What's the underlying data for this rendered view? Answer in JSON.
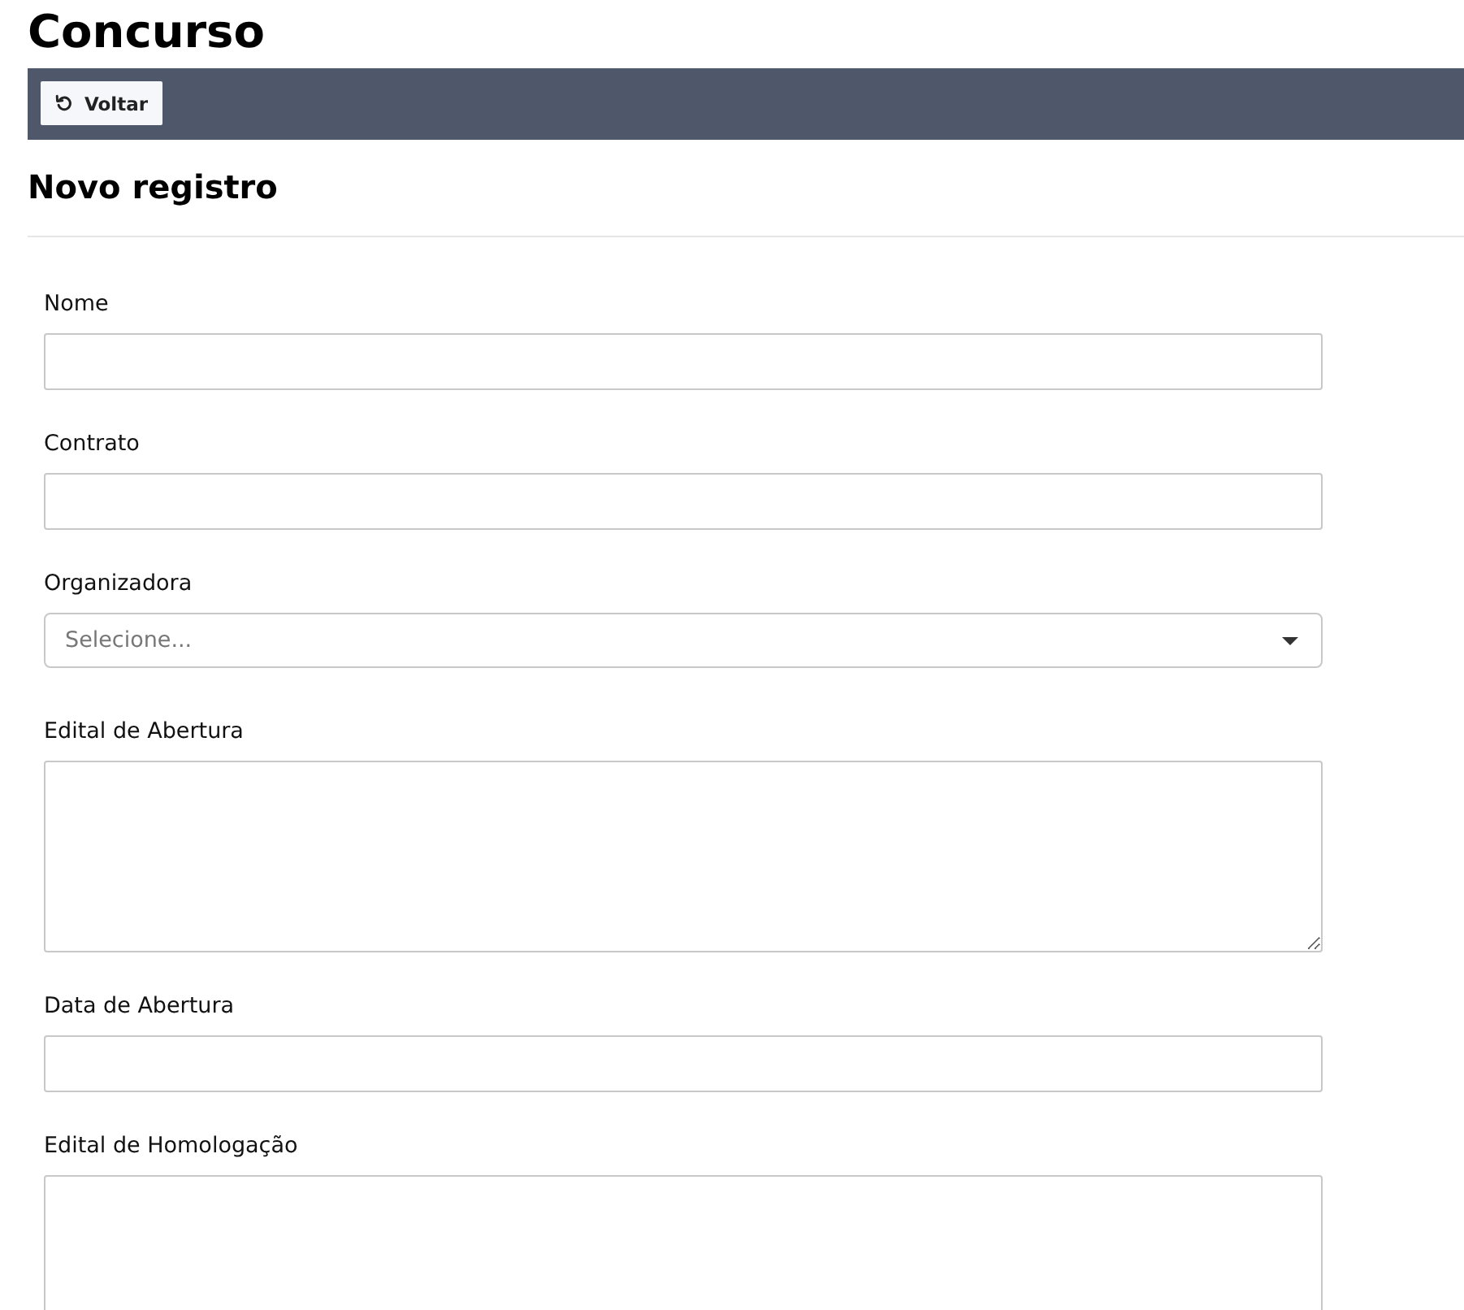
{
  "page": {
    "title": "Concurso"
  },
  "toolbar": {
    "buttons": [
      {
        "label": "Voltar",
        "kind": "back"
      }
    ]
  },
  "form": {
    "title": "Novo registro",
    "fields": [
      {
        "label": "Nome",
        "kind": "text"
      },
      {
        "label": "Contrato",
        "kind": "text"
      },
      {
        "label": "Organizadora",
        "kind": "select",
        "placeholder": "Selecione..."
      },
      {
        "label": "Edital de Abertura",
        "kind": "textarea"
      },
      {
        "label": "Data de Abertura",
        "kind": "text"
      },
      {
        "label": "Edital de Homologação",
        "kind": "textarea"
      }
    ]
  }
}
